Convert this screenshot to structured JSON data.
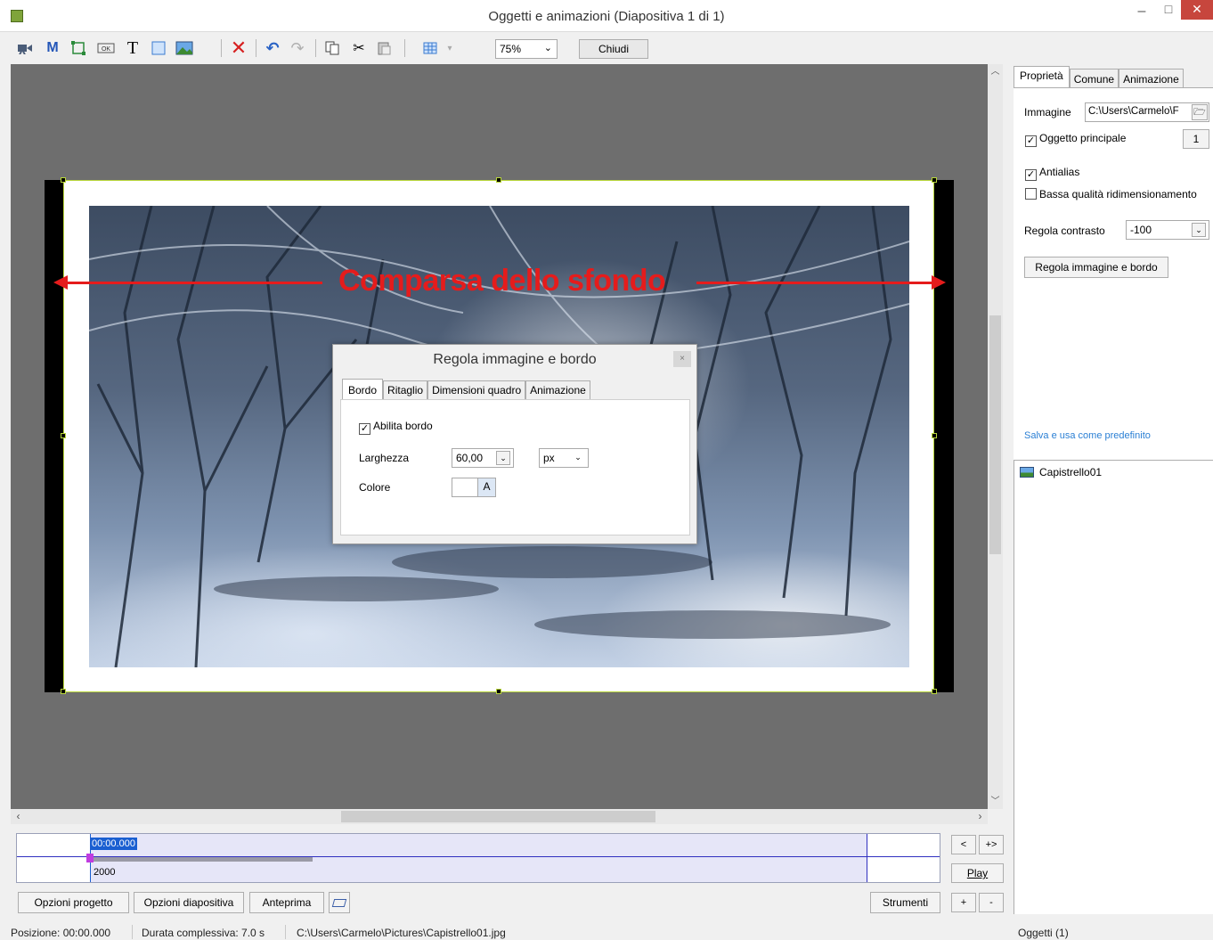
{
  "window": {
    "title": "Oggetti e animazioni  (Diapositiva 1 di 1)",
    "minimize": "–",
    "maximize": "□",
    "close": "✕"
  },
  "toolbar": {
    "zoom_value": "75%",
    "close_label": "Chiudi"
  },
  "canvas": {
    "overlay_text": "Comparsa dello sfondo"
  },
  "dialog": {
    "title": "Regola immagine e bordo",
    "close": "×",
    "tabs": [
      "Bordo",
      "Ritaglio",
      "Dimensioni quadro",
      "Animazione"
    ],
    "enable_border_label": "Abilita bordo",
    "enable_border_checked": true,
    "width_label": "Larghezza",
    "width_value": "60,00",
    "unit_value": "px",
    "color_label": "Colore",
    "color_button": "A"
  },
  "timeline": {
    "time": "00:00.000",
    "value": "2000",
    "nav_prev": "<",
    "nav_expand": "+>",
    "play_label": "Play",
    "plus": "+",
    "minus": "-"
  },
  "bottom_buttons": {
    "project_options": "Opzioni progetto",
    "slide_options": "Opzioni diapositiva",
    "preview": "Anteprima",
    "tools": "Strumenti"
  },
  "status": {
    "position": "Posizione:  00:00.000",
    "duration": "Durata complessiva:  7.0 s",
    "file": "C:\\Users\\Carmelo\\Pictures\\Capistrello01.jpg",
    "objects": "Oggetti (1)"
  },
  "right_panel": {
    "tabs": [
      "Proprietà",
      "Comune",
      "Animazione"
    ],
    "image_label": "Immagine",
    "image_path": "C:\\Users\\Carmelo\\F",
    "main_object_label": "Oggetto principale",
    "main_object_value": "1",
    "antialias_label": "Antialias",
    "low_quality_label": "Bassa qualità ridimensionamento",
    "contrast_label": "Regola contrasto",
    "contrast_value": "-100",
    "adjust_button": "Regola immagine e bordo",
    "save_default_link": "Salva e usa come predefinito"
  },
  "objects": {
    "items": [
      "Capistrello01"
    ]
  }
}
